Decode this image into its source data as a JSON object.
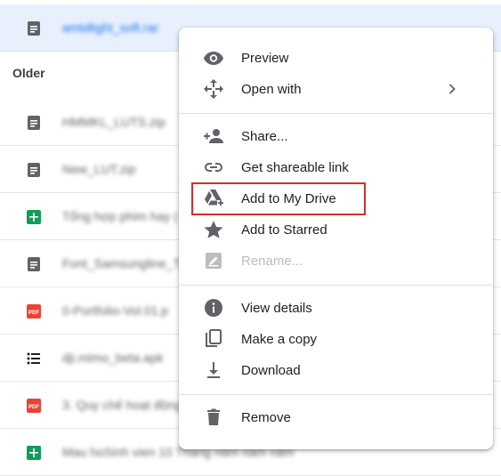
{
  "files": {
    "section_older": "Older",
    "rows": [
      {
        "name": "amtdlight_soft.rar",
        "icon": "doc-icon"
      },
      {
        "name": "HMMKL_LUTS.zip",
        "icon": "doc-icon"
      },
      {
        "name": "New_LUT.zip",
        "icon": "doc-icon"
      },
      {
        "name": "Tổng hợp phim hay (",
        "icon": "sheets-icon"
      },
      {
        "name": "Font_Samsungline_T",
        "icon": "doc-icon"
      },
      {
        "name": "0-Portfolio-Vol.01.p",
        "icon": "pdf-icon"
      },
      {
        "name": "dji.mimo_beta.apk",
        "icon": "list-icon"
      },
      {
        "name": "3. Quy chế hoạt động",
        "icon": "pdf-icon"
      },
      {
        "name": "Mau hoSinh vien 10 Tháng năm năm năm",
        "icon": "sheets-icon"
      }
    ]
  },
  "menu": {
    "preview": "Preview",
    "open_with": "Open with",
    "share": "Share...",
    "get_link": "Get shareable link",
    "add_to_drive": "Add to My Drive",
    "add_to_starred": "Add to Starred",
    "rename": "Rename...",
    "view_details": "View details",
    "make_copy": "Make a copy",
    "download": "Download",
    "remove": "Remove"
  },
  "colors": {
    "selection": "#e8f0fe",
    "highlight_border": "#d32f2f",
    "icon_gray": "#5f6368",
    "pdf_red": "#ea4335",
    "sheets_green": "#0f9d58"
  }
}
